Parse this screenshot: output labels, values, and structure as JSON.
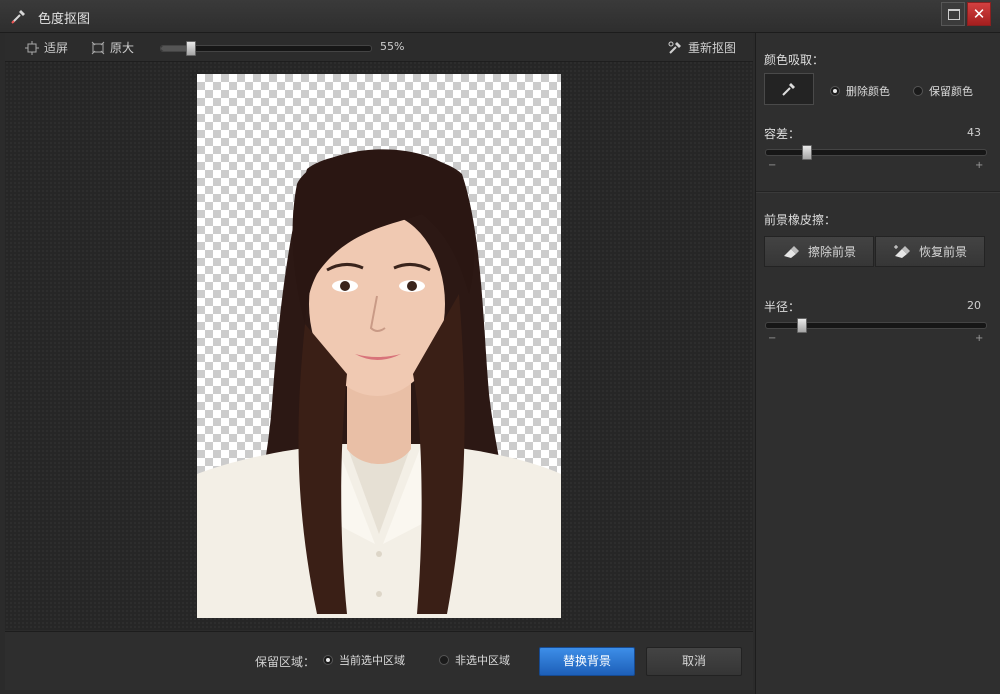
{
  "window": {
    "title": "色度抠图",
    "close_glyph": "✕"
  },
  "toolbar": {
    "fit_label": "适屏",
    "actual_size_label": "原大",
    "zoom_value": "55%",
    "zoom_fraction": 0.14,
    "reset_label": "重新抠图"
  },
  "bottom": {
    "keep_area_label": "保留区域：",
    "options": [
      {
        "label": "当前选中区域",
        "selected": true
      },
      {
        "label": "非选中区域",
        "selected": false
      }
    ],
    "replace_bg_label": "替换背景",
    "cancel_label": "取消"
  },
  "panel": {
    "color_pick_label": "颜色吸取：",
    "color_options": [
      {
        "label": "删除颜色",
        "selected": true
      },
      {
        "label": "保留颜色",
        "selected": false
      }
    ],
    "tolerance_label": "容差：",
    "tolerance_value": "43",
    "tolerance_fraction": 0.18,
    "minus": "−",
    "plus": "+",
    "eraser_label": "前景橡皮擦：",
    "erase_fg_label": "擦除前景",
    "restore_fg_label": "恢复前景",
    "radius_label": "半径：",
    "radius_value": "20",
    "radius_fraction": 0.16
  },
  "icons": {
    "app": "eyedropper-icon",
    "fit": "fit-screen-icon",
    "actual": "actual-size-icon",
    "reset": "reset-cutout-icon",
    "picker": "eyedropper-icon",
    "erase": "eraser-icon",
    "restore": "eraser-plus-icon"
  },
  "colors": {
    "primary_button": "#2a78d8",
    "close_button": "#c03030",
    "background": "#2b2b2b"
  }
}
